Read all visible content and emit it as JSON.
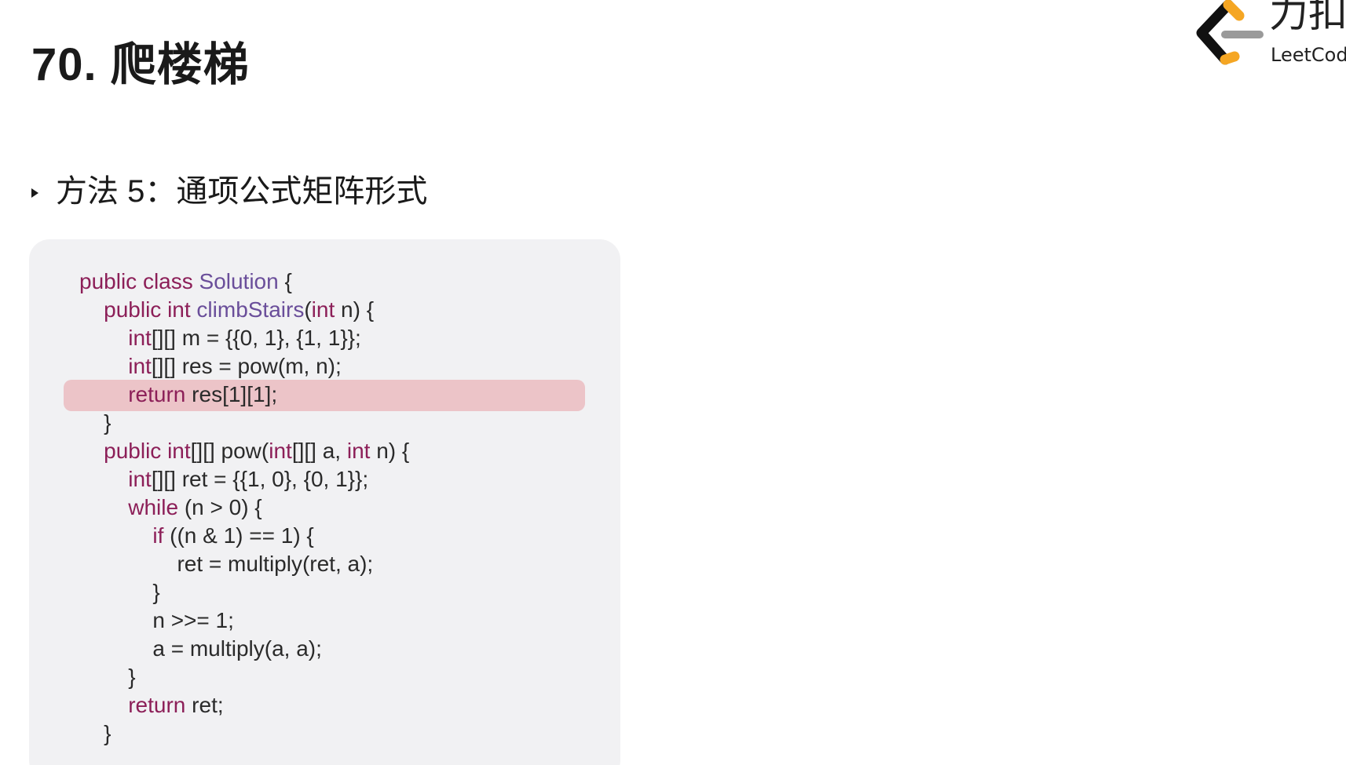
{
  "header": {
    "title": "70. 爬楼梯",
    "logo_cn": "力扣",
    "logo_en": "LeetCode"
  },
  "section": {
    "label": "方法 5：通项公式矩阵形式"
  },
  "code": {
    "highlighted_line": 4,
    "lines": [
      [
        {
          "t": "kw",
          "s": "public class "
        },
        {
          "t": "cls",
          "s": "Solution"
        },
        {
          "t": "plain",
          "s": " {"
        }
      ],
      [
        {
          "t": "plain",
          "s": "    "
        },
        {
          "t": "kw",
          "s": "public int "
        },
        {
          "t": "fn",
          "s": "climbStairs"
        },
        {
          "t": "plain",
          "s": "("
        },
        {
          "t": "kw",
          "s": "int"
        },
        {
          "t": "plain",
          "s": " n) {"
        }
      ],
      [
        {
          "t": "plain",
          "s": "        "
        },
        {
          "t": "kw",
          "s": "int"
        },
        {
          "t": "plain",
          "s": "[][] m = {{0, 1}, {1, 1}};"
        }
      ],
      [
        {
          "t": "plain",
          "s": "        "
        },
        {
          "t": "kw",
          "s": "int"
        },
        {
          "t": "plain",
          "s": "[][] res = pow(m, n);"
        }
      ],
      [
        {
          "t": "plain",
          "s": "        "
        },
        {
          "t": "kw",
          "s": "return"
        },
        {
          "t": "plain",
          "s": " res[1][1];"
        }
      ],
      [
        {
          "t": "plain",
          "s": "    }"
        }
      ],
      [
        {
          "t": "plain",
          "s": "    "
        },
        {
          "t": "kw",
          "s": "public int"
        },
        {
          "t": "plain",
          "s": "[][] pow("
        },
        {
          "t": "kw",
          "s": "int"
        },
        {
          "t": "plain",
          "s": "[][] a, "
        },
        {
          "t": "kw",
          "s": "int"
        },
        {
          "t": "plain",
          "s": " n) {"
        }
      ],
      [
        {
          "t": "plain",
          "s": "        "
        },
        {
          "t": "kw",
          "s": "int"
        },
        {
          "t": "plain",
          "s": "[][] ret = {{1, 0}, {0, 1}};"
        }
      ],
      [
        {
          "t": "plain",
          "s": "        "
        },
        {
          "t": "kw",
          "s": "while"
        },
        {
          "t": "plain",
          "s": " (n > 0) {"
        }
      ],
      [
        {
          "t": "plain",
          "s": "            "
        },
        {
          "t": "kw",
          "s": "if"
        },
        {
          "t": "plain",
          "s": " ((n & 1) == 1) {"
        }
      ],
      [
        {
          "t": "plain",
          "s": "                ret = multiply(ret, a);"
        }
      ],
      [
        {
          "t": "plain",
          "s": "            }"
        }
      ],
      [
        {
          "t": "plain",
          "s": "            n >>= 1;"
        }
      ],
      [
        {
          "t": "plain",
          "s": "            a = multiply(a, a);"
        }
      ],
      [
        {
          "t": "plain",
          "s": "        }"
        }
      ],
      [
        {
          "t": "plain",
          "s": "        "
        },
        {
          "t": "kw",
          "s": "return"
        },
        {
          "t": "plain",
          "s": " ret;"
        }
      ],
      [
        {
          "t": "plain",
          "s": "    }"
        }
      ]
    ]
  },
  "colors": {
    "keyword": "#8c1f58",
    "identifier": "#6a4e9a",
    "highlight": "#ecc4c8",
    "code_background": "#f1f1f3",
    "logo_orange": "#f5a623"
  }
}
